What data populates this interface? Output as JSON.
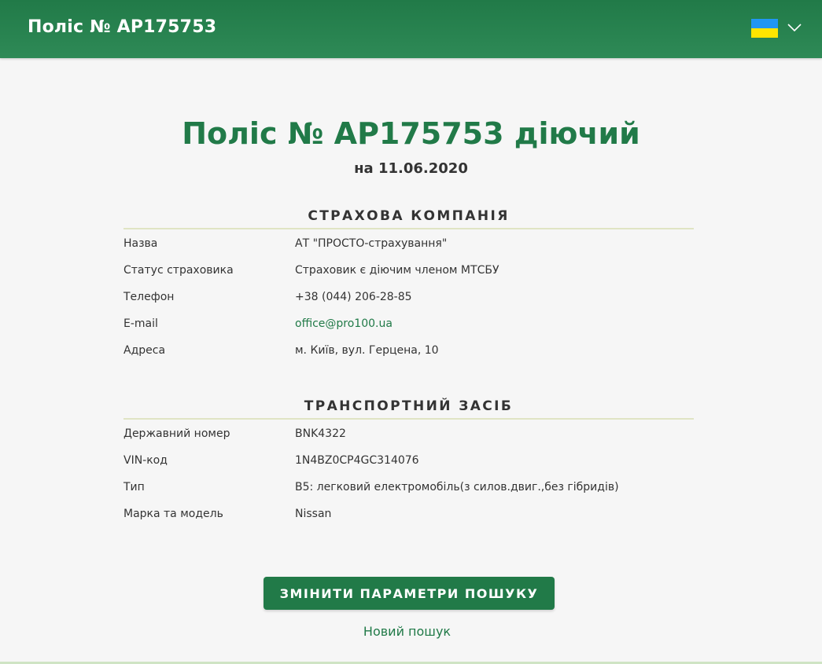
{
  "header": {
    "title": "Поліс № AP175753",
    "language_icon": "ukraine-flag-icon",
    "chevron_icon": "chevron-down-icon",
    "colors": {
      "header_bg": "#217a48",
      "flag_blue": "#2196f3",
      "flag_yellow": "#ffe500"
    }
  },
  "main": {
    "title": "Поліс № AP175753 діючий",
    "date_line": "на 11.06.2020"
  },
  "insurer": {
    "section_title": "СТРАХОВА КОМПАНІЯ",
    "rows": [
      {
        "label": "Назва",
        "value": "АТ \"ПРОСТО-страхування\""
      },
      {
        "label": "Статус страховика",
        "value": "Страховик є діючим членом МТСБУ"
      },
      {
        "label": "Телефон",
        "value": "+38 (044) 206-28-85"
      },
      {
        "label": "E-mail",
        "value": "office@pro100.ua"
      },
      {
        "label": "Адреса",
        "value": "м. Київ, вул. Герцена, 10"
      }
    ]
  },
  "vehicle": {
    "section_title": "ТРАНСПОРТНИЙ ЗАСІБ",
    "rows": [
      {
        "label": "Державний номер",
        "value": "BNK4322"
      },
      {
        "label": "VIN-код",
        "value": "1N4BZ0CP4GC314076"
      },
      {
        "label": "Тип",
        "value": "B5: легковий електромобіль(з силов.двиг.,без гібридів)"
      },
      {
        "label": "Марка та модель",
        "value": "Nissan"
      }
    ]
  },
  "actions": {
    "change_params_label": "ЗМІНИТИ ПАРАМЕТРИ ПОШУКУ",
    "new_search_label": "Новий пошук",
    "accent_color": "#217a48"
  }
}
